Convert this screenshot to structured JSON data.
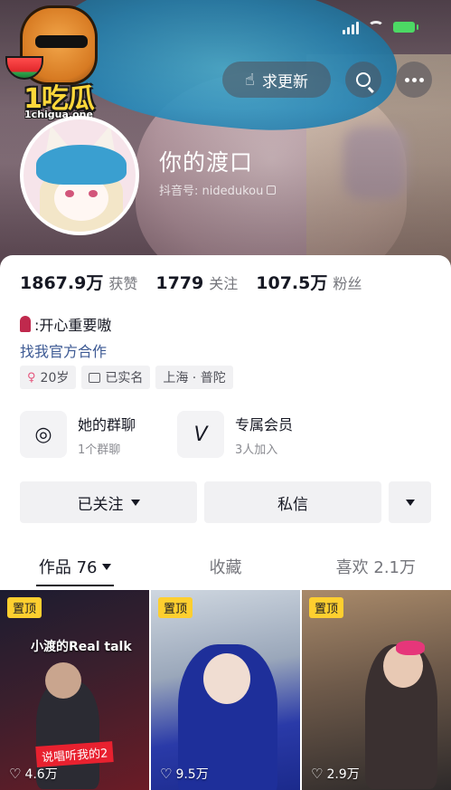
{
  "watermark": {
    "logo_text": "1吃瓜",
    "url": "1chigua.one"
  },
  "header": {
    "update_button": "求更新",
    "nickname": "你的渡口",
    "douyin_id": "抖音号: nidedukou"
  },
  "stats": [
    {
      "value": "1867.9万",
      "label": "获赞"
    },
    {
      "value": "1779",
      "label": "关注"
    },
    {
      "value": "107.5万",
      "label": "粉丝"
    }
  ],
  "bio": {
    "text": ":开心重要嗷",
    "collab_link": "找我官方合作"
  },
  "tags": {
    "age": "20岁",
    "verified": "已实名",
    "location": "上海 · 普陀"
  },
  "features": {
    "group_chat": {
      "title": "她的群聊",
      "subtitle": "1个群聊"
    },
    "membership": {
      "title": "专属会员",
      "subtitle": "3人加入"
    }
  },
  "actions": {
    "following": "已关注",
    "message": "私信"
  },
  "tabs": {
    "works": "作品 76",
    "favorites": "收藏",
    "likes": "喜欢 2.1万"
  },
  "videos": [
    {
      "pinned": "置顶",
      "likes": "4.6万",
      "caption": "小渡的Real talk",
      "banner": "说唱听我的2"
    },
    {
      "pinned": "置顶",
      "likes": "9.5万"
    },
    {
      "pinned": "置顶",
      "likes": "2.9万"
    }
  ],
  "colors": {
    "pin": "#fecf2f",
    "link": "#3d5a94",
    "accent": "#e5557c"
  }
}
